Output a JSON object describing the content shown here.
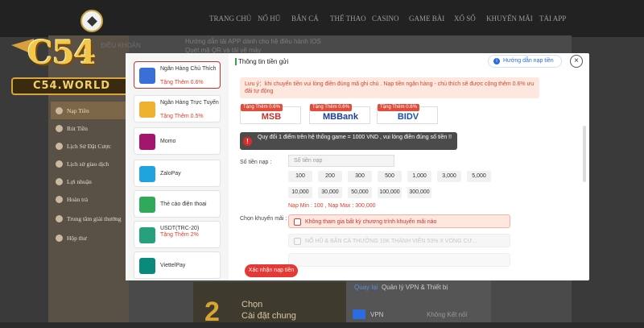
{
  "nav": {
    "items": [
      "TRANG CHỦ",
      "NỔ HŨ",
      "BẮN CÁ",
      "THỂ THAO",
      "CASINO",
      "GAME BÀI",
      "XỔ SỐ",
      "KHUYẾN MÃI",
      "TẢI APP"
    ]
  },
  "logo": {
    "main": "C54",
    "sub": "C54.WORLD"
  },
  "background": {
    "tab_label": "ĐIỀU KHOẢN",
    "header_line1": "Hướng dẫn tải APP dành cho hệ điều hành IOS",
    "header_line2": "Quét mã QR và tải về máy",
    "banner_digit": "2",
    "banner_line1": "Chọn",
    "banner_line2": "Cài đặt chung",
    "phone_back": "Quay lại",
    "phone_title": "Quản lý VPN & Thiết bị",
    "phone_vpn": "VPN",
    "phone_vpn_status": "Không Kết nối"
  },
  "sidemenu": {
    "items": [
      {
        "label": "Nạp Tiền",
        "active": true
      },
      {
        "label": "Rút Tiền"
      },
      {
        "label": "Lịch Sử Đặt Cược"
      },
      {
        "label": "Lịch sử giao dịch"
      },
      {
        "label": "Lợi nhuận"
      },
      {
        "label": "Hoàn trả"
      },
      {
        "label": "Trung tâm giải thưởng"
      },
      {
        "label": "Hộp thư"
      }
    ]
  },
  "methods": [
    {
      "name": "Ngân Hàng Chủ Thích",
      "bonus": "Tặng Thêm 0.6%",
      "icon": "bank-card-icon",
      "color": "#3a6fd8"
    },
    {
      "name": "Ngân Hàng Trực Tuyến",
      "bonus": "Tặng Thêm 0.5%",
      "icon": "online-bank-icon",
      "color": "#f0b030"
    },
    {
      "name": "Momo",
      "bonus": "",
      "icon": "momo-icon",
      "color": "#a3156e"
    },
    {
      "name": "ZaloPay",
      "bonus": "",
      "icon": "zalopay-icon",
      "color": "#1fa4e0"
    },
    {
      "name": "Thẻ cào điện thoại",
      "bonus": "",
      "icon": "phone-card-icon",
      "color": "#2faa5a"
    },
    {
      "name": "USDT(TRC-20)",
      "bonus": "Tặng Thêm 2%",
      "icon": "usdt-icon",
      "color": "#26a17b"
    },
    {
      "name": "ViettelPay",
      "bonus": "",
      "icon": "viettelpay-icon",
      "color": "#0a8a7a"
    }
  ],
  "modal": {
    "title": "Thông tin tiền gửi",
    "guide": "Hướng dẫn nạp tiền",
    "close": "×",
    "notice": "Lưu ý：khi chuyển tiền vui lòng điền đúng mã ghi chú . Nạp tiền ngân hàng - chủ thích sẽ được cộng thêm 0.6% ưu đãi tự động",
    "banks": [
      {
        "bonus": "Tặng Thêm 0.6%",
        "name": "MSB",
        "color": "#c9332e"
      },
      {
        "bonus": "Tặng Thêm 0.6%",
        "name": "MBBank",
        "color": "#1d3f9c"
      },
      {
        "bonus": "Tặng Thêm 0.6%",
        "name": "BIDV",
        "color": "#1d4fa8"
      }
    ],
    "warning": "Quy đổi 1 điểm trên hệ thống game = 1000 VND , vui lòng điền đúng số tiền !!",
    "amount_label": "Số tiền nạp :",
    "amount_placeholder": "Số tiền nạp",
    "amounts_row1": [
      "100",
      "200",
      "300",
      "500",
      "1,000",
      "3,000",
      "5,000"
    ],
    "amounts_row2": [
      "10,000",
      "30,000",
      "50,000",
      "100,000",
      "300,000"
    ],
    "minmax": "Nạp Min : 100 , Nạp Max : 300,000",
    "promo_label": "Chọn khuyến mãi :",
    "promo_selected": "Không tham gia bất kỳ chương trình khuyến mãi nào",
    "promo_other": "NỔ HŨ & BẮN CÁ THƯỞNG 10K THÀNH VIÊN 53% X VÒNG CƯ...",
    "confirm": "Xác nhận nạp tiền"
  }
}
